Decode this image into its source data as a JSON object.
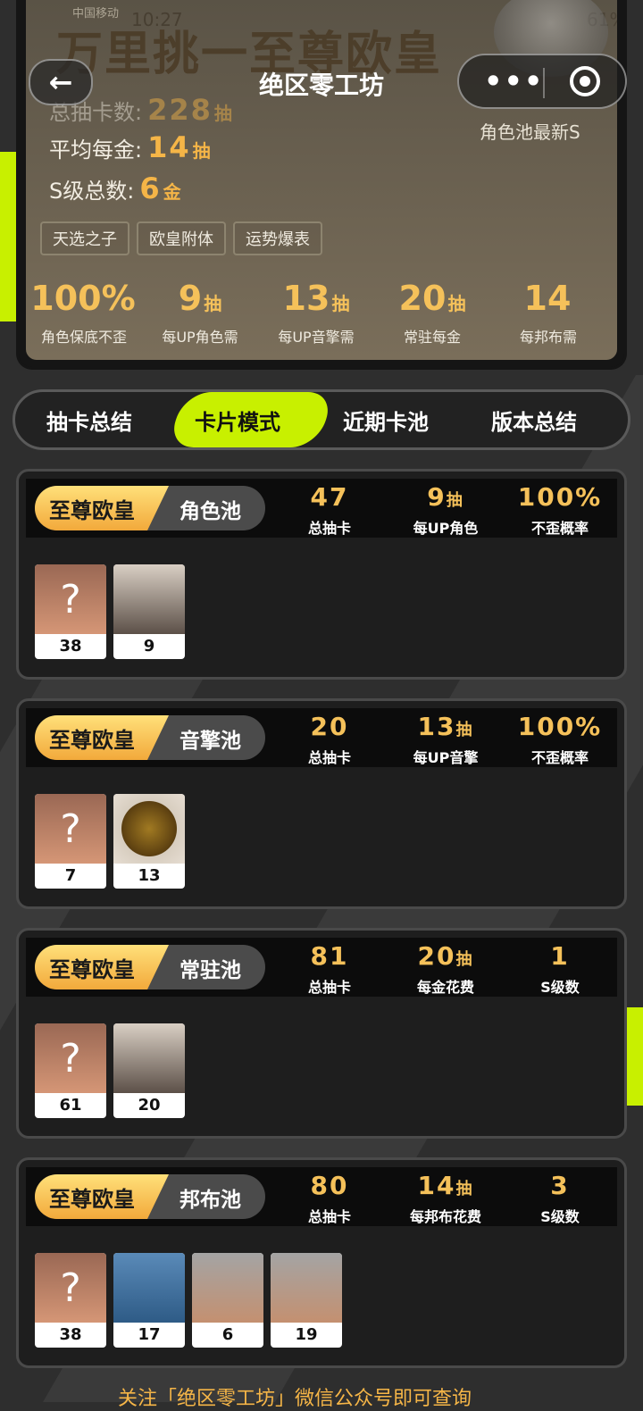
{
  "status": {
    "carrier": "中国移动",
    "time": "10:27",
    "battery": "61%"
  },
  "header": {
    "big_title": "万里挑一至尊欧皇",
    "nav_title": "绝区零工坊",
    "back_icon": "←",
    "menu_dots": "•••"
  },
  "summary": {
    "total_label": "总抽卡数:",
    "total_value": "228",
    "total_unit": "抽",
    "avg_label": "平均每金:",
    "avg_value": "14",
    "avg_unit": "抽",
    "s_label": "S级总数:",
    "s_value": "6",
    "s_unit": "金",
    "latest_label": "角色池最新S",
    "tags": [
      "天选之子",
      "欧皇附体",
      "运势爆表"
    ],
    "mini": [
      {
        "value": "100%",
        "unit": "",
        "label": "角色保底不歪"
      },
      {
        "value": "9",
        "unit": "抽",
        "label": "每UP角色需"
      },
      {
        "value": "13",
        "unit": "抽",
        "label": "每UP音擎需"
      },
      {
        "value": "20",
        "unit": "抽",
        "label": "常驻每金"
      },
      {
        "value": "14",
        "unit": "",
        "label": "每邦布需"
      }
    ]
  },
  "tabs": [
    "抽卡总结",
    "卡片模式",
    "近期卡池",
    "版本总结"
  ],
  "cards": [
    {
      "rank": "至尊欧皇",
      "pool": "角色池",
      "stats": [
        {
          "value": "47",
          "unit": "",
          "label": "总抽卡"
        },
        {
          "value": "9",
          "unit": "抽",
          "label": "每UP角色"
        },
        {
          "value": "100%",
          "unit": "",
          "label": "不歪概率"
        }
      ],
      "items": [
        {
          "q": "?",
          "count": "38"
        },
        {
          "count": "9"
        }
      ]
    },
    {
      "rank": "至尊欧皇",
      "pool": "音擎池",
      "stats": [
        {
          "value": "20",
          "unit": "",
          "label": "总抽卡"
        },
        {
          "value": "13",
          "unit": "抽",
          "label": "每UP音擎"
        },
        {
          "value": "100%",
          "unit": "",
          "label": "不歪概率"
        }
      ],
      "items": [
        {
          "q": "?",
          "count": "7"
        },
        {
          "count": "13"
        }
      ]
    },
    {
      "rank": "至尊欧皇",
      "pool": "常驻池",
      "stats": [
        {
          "value": "81",
          "unit": "",
          "label": "总抽卡"
        },
        {
          "value": "20",
          "unit": "抽",
          "label": "每金花费"
        },
        {
          "value": "1",
          "unit": "",
          "label": "S级数"
        }
      ],
      "items": [
        {
          "q": "?",
          "count": "61"
        },
        {
          "count": "20"
        }
      ]
    },
    {
      "rank": "至尊欧皇",
      "pool": "邦布池",
      "stats": [
        {
          "value": "80",
          "unit": "",
          "label": "总抽卡"
        },
        {
          "value": "14",
          "unit": "抽",
          "label": "每邦布花费"
        },
        {
          "value": "3",
          "unit": "",
          "label": "S级数"
        }
      ],
      "items": [
        {
          "q": "?",
          "count": "38"
        },
        {
          "count": "17"
        },
        {
          "count": "6"
        },
        {
          "count": "19"
        }
      ]
    }
  ],
  "footer": "关注「绝区零工坊」微信公众号即可查询"
}
